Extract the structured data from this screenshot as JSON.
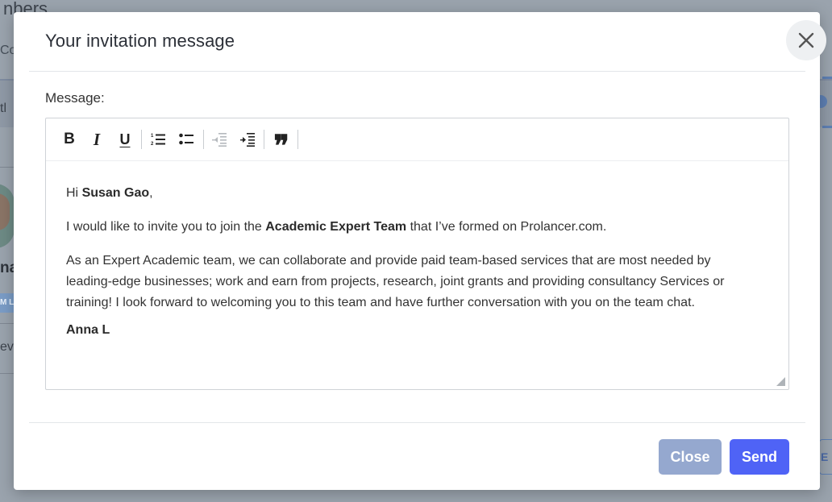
{
  "background": {
    "title_fragment": "nbers",
    "subtitle_fragment": "Col",
    "band_fragment": "tl",
    "name_fragment": "na",
    "chip_fragment": "M L",
    "review_fragment": "ev",
    "right_button_fragment": "E"
  },
  "modal": {
    "title": "Your invitation message",
    "close_icon": "close-icon",
    "message_label": "Message:",
    "toolbar": {
      "bold": "B",
      "italic": "I",
      "underline": "U",
      "ordered_list_icon": "ordered-list-icon",
      "bullet_list_icon": "bullet-list-icon",
      "outdent_icon": "outdent-icon",
      "indent_icon": "indent-icon",
      "blockquote": "❞"
    },
    "body": {
      "greeting_prefix": "Hi ",
      "recipient": "Susan Gao",
      "greeting_suffix": ",",
      "line1_prefix": "I would like to invite you to join the ",
      "team_name": "Academic Expert Team",
      "line1_suffix": " that I’ve formed on Prolancer.com.",
      "paragraph2": "As an Expert Academic team, we can collaborate and provide paid team-based services that are most needed by leading-edge businesses; work and earn from projects, research, joint grants and providing consultancy Services or training! I look forward to welcoming you to this team and have further conversation with you on the team chat.",
      "signature": "Anna L"
    },
    "buttons": {
      "close_label": "Close",
      "send_label": "Send"
    }
  },
  "colors": {
    "send": "#4f63f6",
    "close": "#95a8cf"
  }
}
